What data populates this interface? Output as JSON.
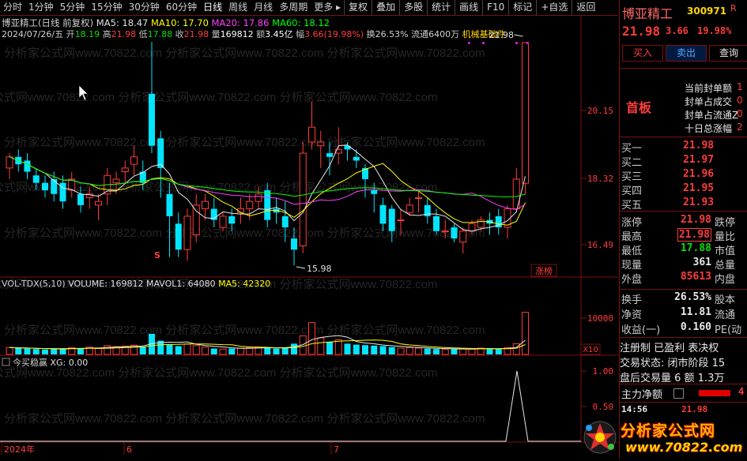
{
  "toolbar": {
    "tabs": [
      "分时",
      "1分钟",
      "5分钟",
      "15分钟",
      "30分钟",
      "60分钟",
      "日线",
      "周线",
      "月线",
      "多周期",
      "更多"
    ],
    "active_tab": "日线",
    "buttons": [
      "复权",
      "叠加",
      "多股",
      "统计",
      "画线",
      "F10",
      "标记",
      "+自选",
      "返回"
    ]
  },
  "legend": {
    "title": "博亚精工(日线 前复权)",
    "ma5": "MA5: 18.47",
    "ma10": "MA10: 17.70",
    "ma20": "MA20: 17.86",
    "ma60": "MA60: 18.12",
    "date": "2024/07/26/五",
    "open_label": "开",
    "open": "18.19",
    "high_label": "高",
    "high": "21.98",
    "low_label": "低",
    "low": "17.88",
    "close_label": "收",
    "close": "21.98",
    "vol_label": "量",
    "vol": "169812",
    "amount_label": "额",
    "amount": "3.45亿",
    "change_label": "幅",
    "change": "3.66(19.98%)",
    "turnover": "换26.53%",
    "float_mv": "流通6400万",
    "sector": "机械基础件"
  },
  "price_axis": {
    "ticks": [
      "20.15",
      "18.32",
      "16.49"
    ]
  },
  "annotations": {
    "high_label": "21.98",
    "low_label": "15.98",
    "limit_badge": "涨榜"
  },
  "volume_panel": {
    "header": "VOL-TDX(5,10)",
    "volume": "VOLUME: 169812",
    "mavol1": "MAVOL1: 64080",
    "ma5": "MA5: 42320",
    "axis_tick": "10000",
    "unit": "X10"
  },
  "indicator_panel": {
    "header": "今买稳赢",
    "xg": "XG: 0.00",
    "ticks": [
      "1.00",
      "0.50"
    ]
  },
  "date_axis": {
    "labels": [
      "2024年",
      "6",
      "7"
    ]
  },
  "watermark": {
    "text": "分析家公式网www.70822.com",
    "logo_title": "分析家公式网",
    "logo_url": "www.70822.com"
  },
  "right_panel": {
    "name": "博亚精工",
    "code": "300971",
    "flag": "R",
    "price": "21.98",
    "delta": "3.66",
    "pct": "19.98%",
    "buy_btn": "买入",
    "sell_btn": "卖出",
    "query_btn": "查询",
    "badge": "首板",
    "stats": [
      {
        "label": "当前封单额",
        "value": "1"
      },
      {
        "label": "封单占成交",
        "value": "0"
      },
      {
        "label": "封单占流通Z",
        "value": "0"
      },
      {
        "label": "十日总涨幅",
        "value": "2"
      }
    ],
    "orderbook": [
      {
        "label": "买一",
        "price": "21.98"
      },
      {
        "label": "买二",
        "price": "21.97"
      },
      {
        "label": "买三",
        "price": "21.96"
      },
      {
        "label": "买四",
        "price": "21.95"
      },
      {
        "label": "买五",
        "price": "21.93"
      }
    ],
    "quote": [
      {
        "l": "涨停",
        "v": "21.98",
        "r": "跌停",
        "color": "red"
      },
      {
        "l": "最高",
        "v": "21.98",
        "r": "量比",
        "color": "red",
        "boxed": true
      },
      {
        "l": "最低",
        "v": "17.88",
        "r": "市值",
        "color": "green"
      },
      {
        "l": "现量",
        "v": "361",
        "r": "总量",
        "color": "white"
      },
      {
        "l": "外盘",
        "v": "85613",
        "r": "内盘",
        "color": "red"
      }
    ],
    "quote2": [
      {
        "l": "换手",
        "v": "26.53%",
        "r": "股本"
      },
      {
        "l": "净资",
        "v": "11.81",
        "r": "流通"
      },
      {
        "l": "收益(一)",
        "v": "0.160",
        "r": "PE(动"
      }
    ],
    "tags": "注册制 已盈利 表决权",
    "trade_state": "交易状态: 闭市阶段 15",
    "after_hours": "盘后交易量 6 额 1.3万",
    "capital_label": "主力净额",
    "capital_value": "4",
    "tick_time": "14:56",
    "tick_price": "21.98"
  }
}
